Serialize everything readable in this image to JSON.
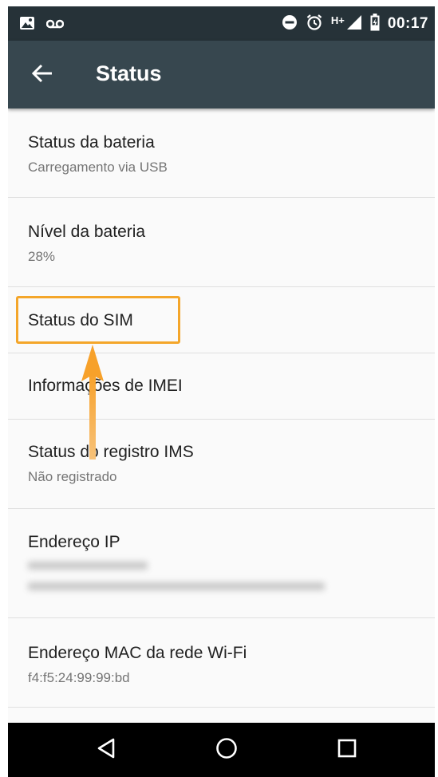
{
  "status_bar": {
    "time": "00:17",
    "network_type": "H+",
    "icons": [
      "image-notification-icon",
      "voicemail-icon",
      "do-not-disturb-icon",
      "alarm-icon",
      "signal-icon",
      "battery-charging-icon"
    ]
  },
  "app_bar": {
    "title": "Status",
    "back_icon": "arrow-back-icon"
  },
  "items": [
    {
      "title": "Status da bateria",
      "summary": "Carregamento via USB"
    },
    {
      "title": "Nível da bateria",
      "summary": "28%"
    },
    {
      "title": "Status do SIM",
      "summary": ""
    },
    {
      "title": "Informações de IMEI",
      "summary": ""
    },
    {
      "title": "Status do registro IMS",
      "summary": "Não registrado"
    },
    {
      "title": "Endereço IP",
      "summary": "",
      "summary_line2": ""
    },
    {
      "title": "Endereço MAC da rede Wi-Fi",
      "summary": "f4:f5:24:99:99:bd"
    }
  ],
  "nav_bar": {
    "icons": [
      "back-triangle-icon",
      "home-circle-icon",
      "recents-square-icon"
    ]
  },
  "colors": {
    "status_bar": "#263238",
    "app_bar": "#37474f",
    "highlight": "#f4a62a",
    "background": "#fafafa"
  }
}
